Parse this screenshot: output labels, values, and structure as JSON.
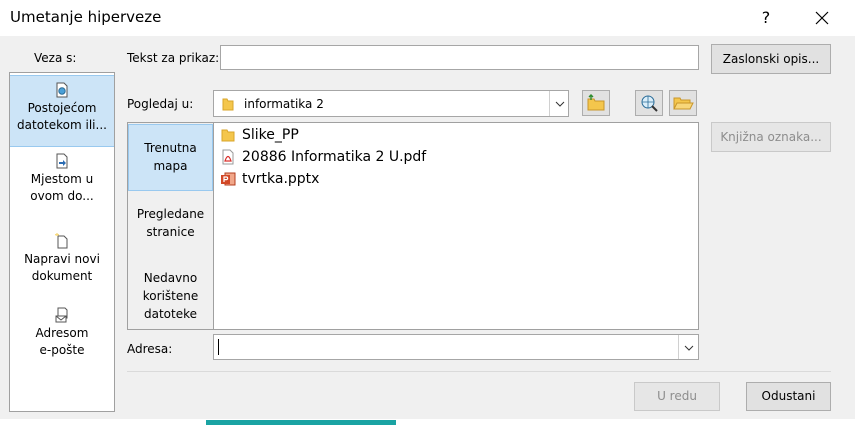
{
  "window": {
    "title": "Umetanje hiperveze",
    "help_label": "?"
  },
  "link_to": {
    "label": "Veza s:",
    "items": [
      {
        "line1": "Postojećom",
        "line2": "datotekom ili..."
      },
      {
        "line1": "Mjestom u",
        "line2": "ovom do..."
      },
      {
        "line1": "Napravi novi",
        "line2": "dokument"
      },
      {
        "line1": "Adresom",
        "line2": "e-pošte"
      }
    ]
  },
  "display_text": {
    "label": "Tekst za prikaz:",
    "value": ""
  },
  "screentip_label": "Zaslonski opis...",
  "look_in": {
    "label": "Pogledaj u:",
    "value": "informatika 2"
  },
  "view_tabs": [
    {
      "line1": "Trenutna",
      "line2": "mapa",
      "line3": ""
    },
    {
      "line1": "Pregledane",
      "line2": "stranice",
      "line3": ""
    },
    {
      "line1": "Nedavno",
      "line2": "korištene",
      "line3": "datoteke"
    }
  ],
  "files": [
    {
      "name": "Slike_PP",
      "icon": "folder-icon"
    },
    {
      "name": "20886 Informatika 2 U.pdf",
      "icon": "pdf-file-icon"
    },
    {
      "name": "tvrtka.pptx",
      "icon": "powerpoint-file-icon"
    }
  ],
  "bookmark_label": "Knjižna oznaka...",
  "address": {
    "label": "Adresa:",
    "value": ""
  },
  "ok_label": "U redu",
  "cancel_label": "Odustani",
  "colors": {
    "selection": "#cce4f7",
    "selection_border": "#99c9ef",
    "folder": "#f4c64c",
    "pdf": "#d9302c",
    "powerpoint": "#d24726"
  }
}
